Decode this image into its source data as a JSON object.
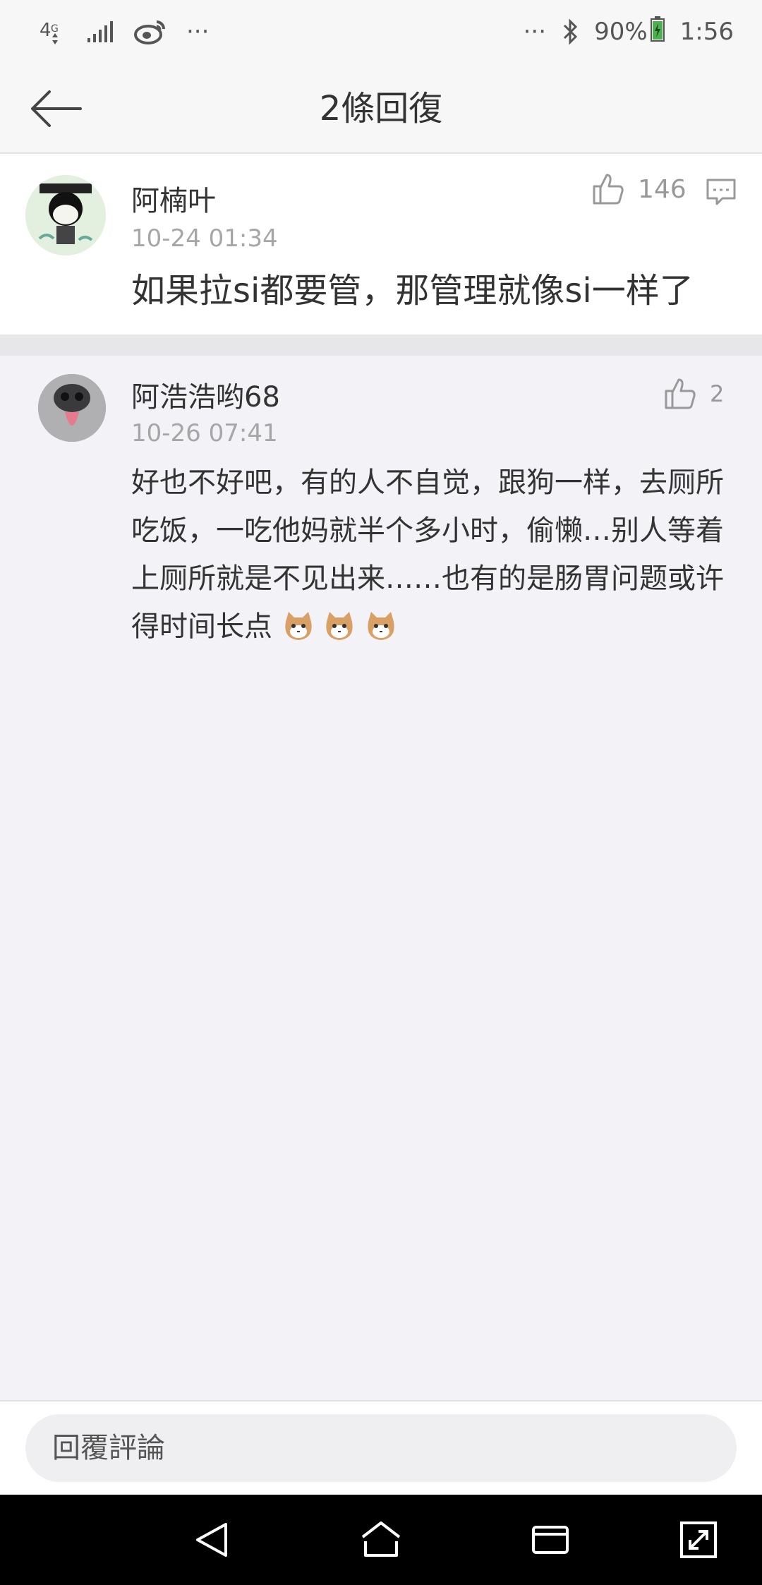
{
  "status_bar": {
    "network": "4G",
    "more_left": "···",
    "more_right": "···",
    "battery": "90%",
    "time": "1:56"
  },
  "header": {
    "title": "2條回復"
  },
  "top_comment": {
    "username": "阿楠叶",
    "timestamp": "10-24 01:34",
    "likes": "146",
    "text": "如果拉si都要管，那管理就像si一样了"
  },
  "replies": [
    {
      "username": "阿浩浩哟68",
      "timestamp": "10-26 07:41",
      "likes": "2",
      "text": "好也不好吧，有的人不自觉，跟狗一样，去厕所吃饭，一吃他妈就半个多小时，偷懒…别人等着上厕所就是不见出来……也有的是肠胃问题或许得时间长点",
      "emojis": [
        "cat-emoji",
        "cat-emoji",
        "cat-emoji"
      ]
    }
  ],
  "bottom": {
    "placeholder": "回覆評論"
  },
  "icons": {
    "back": "arrow-left-icon",
    "like": "thumbs-up-icon",
    "reply": "comment-icon",
    "nav_back": "triangle-back-icon",
    "nav_home": "home-icon",
    "nav_recent": "recent-apps-icon",
    "nav_expand": "expand-icon"
  },
  "colors": {
    "battery_fill": "#4caf50",
    "nav_background": "#000000",
    "muted_text": "#a6a6a6"
  }
}
